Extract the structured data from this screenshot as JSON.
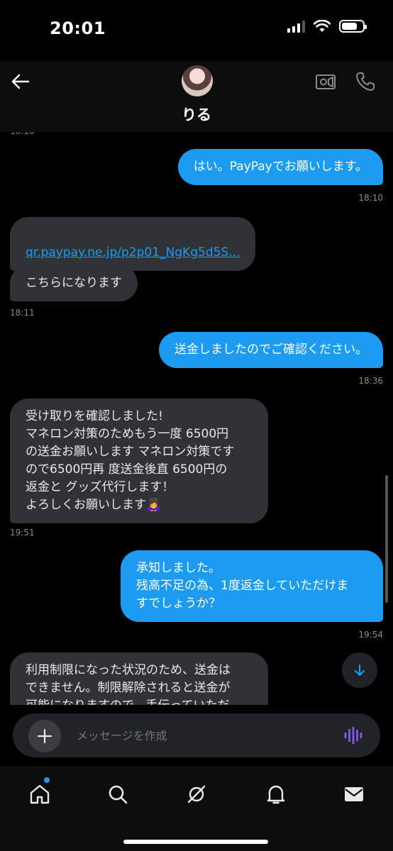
{
  "status_bar": {
    "time": "20:01",
    "battery_percent": 75
  },
  "header": {
    "contact_name": "りる",
    "icons": [
      "back-arrow-icon",
      "video-call-icon",
      "phone-icon"
    ]
  },
  "messages": [
    {
      "direction": "out",
      "text": "はい。PayPayでお願いします。",
      "time": "18:10"
    },
    {
      "direction": "in",
      "type": "link",
      "text": "qr.paypay.ne.jp/p2p01_NgKg5d5S..."
    },
    {
      "direction": "in",
      "text": "こちらになります",
      "time": "18:11"
    },
    {
      "direction": "out",
      "text": "送金しましたのでご確認ください。",
      "time": "18:36"
    },
    {
      "direction": "in",
      "text": "受け取りを確認しました!\nマネロン対策のためもう一度 6500円\nの送金お願いします マネロン対策です\nので6500円再 度送金後直 6500円の\n返金と グッズ代行します！\nよろしくお願いします🙇‍♀️",
      "time": "19:51"
    },
    {
      "direction": "out",
      "text": "承知しました。\n残高不足の為、1度返金していただけま\nすでしょうか？",
      "time": "19:54"
    },
    {
      "direction": "in",
      "text": "利用制限になった状況のため、送金は\nできません。制限解除されると送金が\n可能になりますので、手伝っていただ"
    }
  ],
  "composer": {
    "placeholder": "メッセージを作成"
  },
  "nav": {
    "items": [
      "home-icon",
      "search-icon",
      "grok-icon",
      "notifications-icon",
      "messages-icon"
    ]
  },
  "colors": {
    "accent": "#1d9bf0",
    "incoming_bubble": "#2f3336",
    "background": "#000000"
  }
}
